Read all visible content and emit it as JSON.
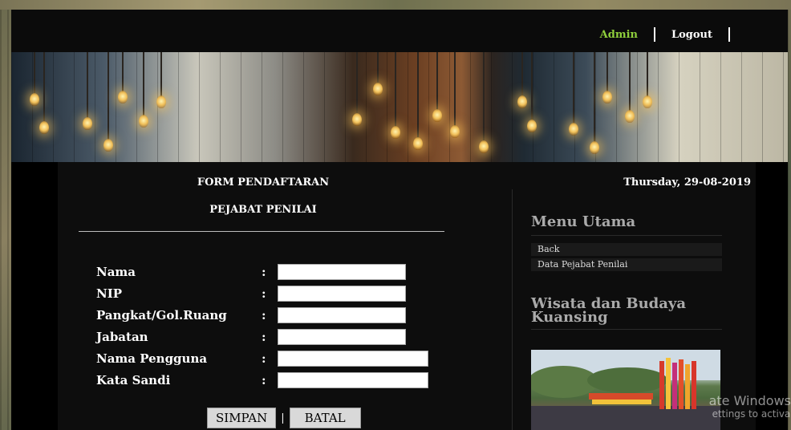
{
  "header": {
    "admin_label": "Admin",
    "logout_label": "Logout"
  },
  "form": {
    "title": "FORM PENDAFTARAN",
    "subtitle": "PEJABAT PENILAI",
    "fields": [
      {
        "label": "Nama",
        "colon": ":",
        "value": ""
      },
      {
        "label": "NIP",
        "colon": ":",
        "value": ""
      },
      {
        "label": "Pangkat/Gol.Ruang",
        "colon": ":",
        "value": ""
      },
      {
        "label": "Jabatan",
        "colon": ":",
        "value": ""
      },
      {
        "label": "Nama Pengguna",
        "colon": ":",
        "value": ""
      },
      {
        "label": "Kata Sandi",
        "colon": ":",
        "value": ""
      }
    ],
    "save_label": "SIMPAN",
    "cancel_label": "BATAL",
    "button_separator": "|"
  },
  "sidebar": {
    "date": "Thursday, 29-08-2019",
    "menu_heading": "Menu Utama",
    "menu_items": [
      {
        "label": "Back"
      },
      {
        "label": "Data Pejabat Penilai"
      }
    ],
    "gallery_heading": "Wisata dan Budaya Kuansing"
  },
  "watermark": {
    "line1": "ate Windows",
    "line2": "ettings to activa"
  },
  "colors": {
    "accent_green": "#8fcf3c",
    "panel": "#0d0d0d",
    "topbar": "#0b0b0b"
  }
}
